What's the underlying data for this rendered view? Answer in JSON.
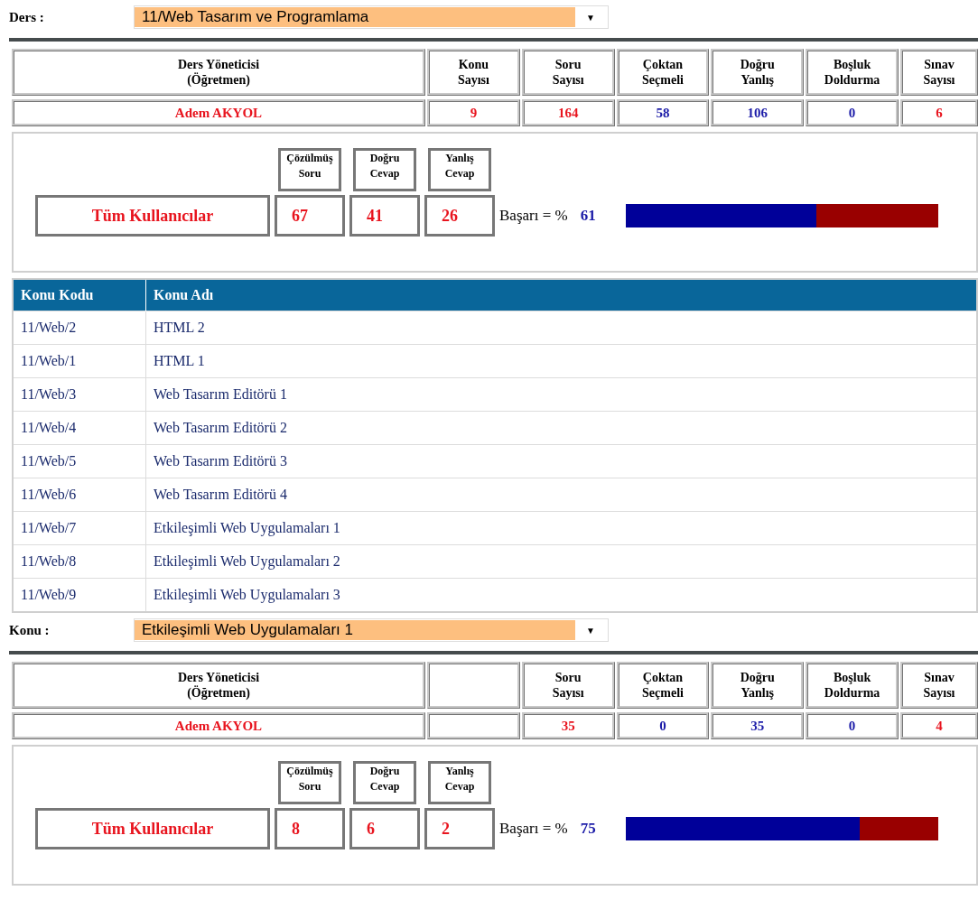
{
  "course_select": {
    "label": "Ders :",
    "value": "11/Web Tasarım ve Programlama",
    "arrow": "▼"
  },
  "course_stats": {
    "columns": [
      {
        "header": "Ders Yöneticisi\n(Öğretmen)",
        "value": "Adem AKYOL",
        "color": "#e8141e",
        "kind": "wide"
      },
      {
        "header": "Konu\nSayısı",
        "value": "9",
        "color": "#e8141e",
        "kind": "num"
      },
      {
        "header": "Soru\nSayısı",
        "value": "164",
        "color": "#e8141e",
        "kind": "num"
      },
      {
        "header": "Çoktan\nSeçmeli",
        "value": "58",
        "color": "#1c1ca8",
        "kind": "num"
      },
      {
        "header": "Doğru\nYanlış",
        "value": "106",
        "color": "#1c1ca8",
        "kind": "num"
      },
      {
        "header": "Boşluk\nDoldurma",
        "value": "0",
        "color": "#1c1ca8",
        "kind": "num"
      },
      {
        "header": "Sınav\nSayısı",
        "value": "6",
        "color": "#e8141e",
        "kind": "num"
      }
    ]
  },
  "course_results": {
    "group": "Tüm Kullanıcılar",
    "columns": [
      {
        "header": "Çözülmüş\nSoru",
        "value": "67"
      },
      {
        "header": "Doğru\nCevap",
        "value": "41"
      },
      {
        "header": "Yanlış\nCevap",
        "value": "26"
      }
    ],
    "success_label": "Başarı = %",
    "success_value": "61",
    "level": 0.61
  },
  "topics": {
    "columns": [
      "Konu Kodu",
      "Konu Adı"
    ],
    "rows": [
      {
        "code": "11/Web/2",
        "name": "HTML 2"
      },
      {
        "code": "11/Web/1",
        "name": "HTML 1"
      },
      {
        "code": "11/Web/3",
        "name": "Web Tasarım Editörü 1"
      },
      {
        "code": "11/Web/4",
        "name": "Web Tasarım Editörü 2"
      },
      {
        "code": "11/Web/5",
        "name": "Web Tasarım Editörü 3"
      },
      {
        "code": "11/Web/6",
        "name": "Web Tasarım Editörü 4"
      },
      {
        "code": "11/Web/7",
        "name": "Etkileşimli Web Uygulamaları 1"
      },
      {
        "code": "11/Web/8",
        "name": "Etkileşimli Web Uygulamaları 2"
      },
      {
        "code": "11/Web/9",
        "name": "Etkileşimli Web Uygulamaları 3"
      }
    ]
  },
  "topic_select": {
    "label": "Konu :",
    "value": "Etkileşimli Web Uygulamaları 1",
    "arrow": "▼"
  },
  "topic_stats": {
    "columns": [
      {
        "header": "Ders Yöneticisi\n(Öğretmen)",
        "value": "Adem AKYOL",
        "color": "#e8141e",
        "kind": "wide"
      },
      {
        "kind": "empty"
      },
      {
        "header": "Soru\nSayısı",
        "value": "35",
        "color": "#e8141e",
        "kind": "num"
      },
      {
        "header": "Çoktan\nSeçmeli",
        "value": "0",
        "color": "#1c1ca8",
        "kind": "num"
      },
      {
        "header": "Doğru\nYanlış",
        "value": "35",
        "color": "#1c1ca8",
        "kind": "num"
      },
      {
        "header": "Boşluk\nDoldurma",
        "value": "0",
        "color": "#1c1ca8",
        "kind": "num"
      },
      {
        "header": "Sınav\nSayısı",
        "value": "4",
        "color": "#e8141e",
        "kind": "num"
      }
    ]
  },
  "topic_results": {
    "group": "Tüm Kullanıcılar",
    "columns": [
      {
        "header": "Çözülmüş\nSoru",
        "value": "8"
      },
      {
        "header": "Doğru\nCevap",
        "value": "6"
      },
      {
        "header": "Yanlış\nCevap",
        "value": "2"
      }
    ],
    "success_label": "Başarı = %",
    "success_value": "75",
    "level": 0.75
  }
}
